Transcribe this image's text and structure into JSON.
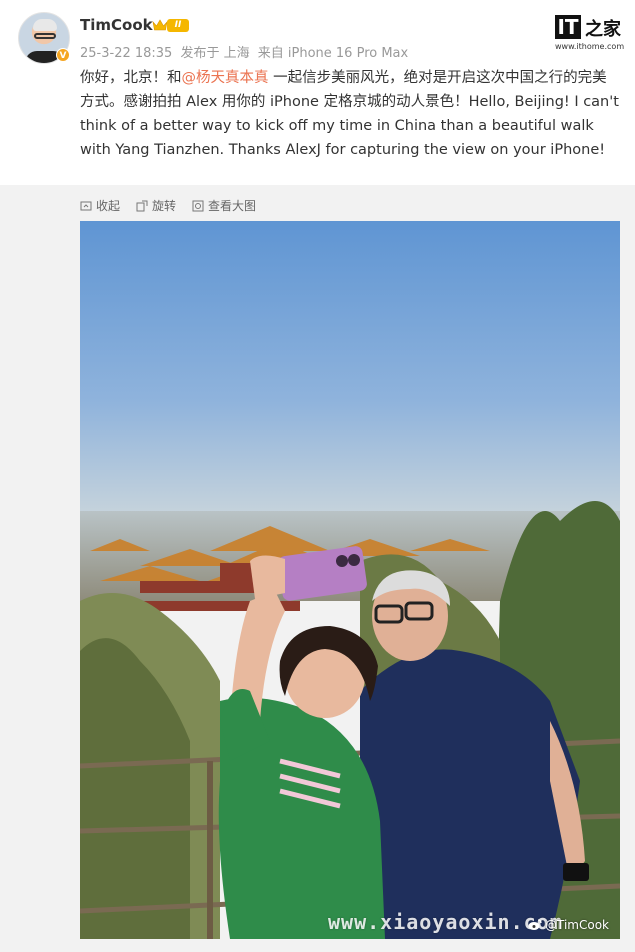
{
  "post": {
    "username": "TimCook",
    "level_badge": "II",
    "verified_mark": "V",
    "timestamp": "25-3-22 18:35",
    "posted_from_label": "发布于 上海",
    "device_label": "来自 iPhone 16 Pro Max",
    "text_part1": "你好，北京！和",
    "mention": "@杨天真本真",
    "text_part2": " 一起信步美丽风光，绝对是开启这次中国之行的完美方式。感谢拍拍 Alex 用你的 iPhone 定格京城的动人景色！Hello, Beijing! I can't think of a better way to kick off my time in China than a beautiful walk with Yang Tianzhen. Thanks AlexJ for capturing the view on your iPhone!"
  },
  "actions": {
    "collapse_label": "收起",
    "rotate_label": "旋转",
    "view_large_label": "查看大图"
  },
  "logo": {
    "main": "IT",
    "char": "之家",
    "url": "www.ithome.com"
  },
  "watermark": {
    "site": "www.xiaoyaoxin.com",
    "weibo": "@TimCook"
  },
  "icons": {
    "crown": "crown-icon",
    "collapse": "collapse-icon",
    "rotate": "rotate-icon",
    "view_large": "view-large-icon",
    "weibo": "weibo-icon"
  },
  "colors": {
    "mention": "#eb7350",
    "badge": "#f5b700",
    "meta": "#999999",
    "sky": "#6a9bd4"
  }
}
